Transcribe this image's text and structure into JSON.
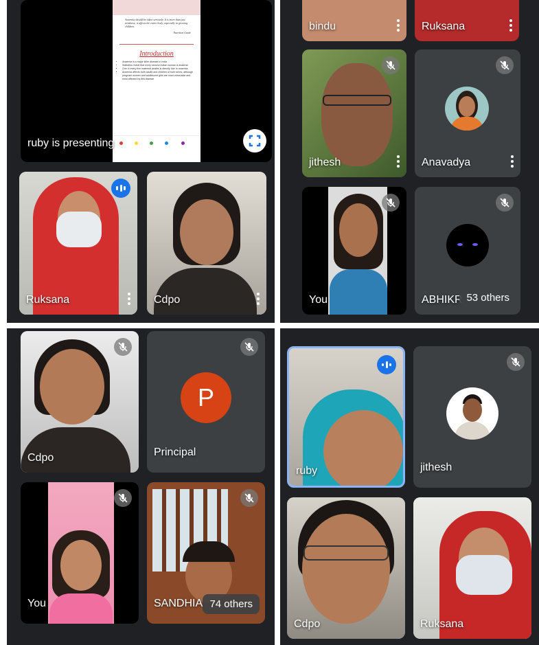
{
  "panel1": {
    "presenter_label": "ruby is presenting",
    "slide": {
      "quote": "Anaemia should be taken seriously. It is more than just tiredness; it affects the entire body, especially in growing children.",
      "quote_author": "Nutrition Guide",
      "heading": "Introduction",
      "bullets": [
        "Anaemia is a major killer disease in India",
        "Statistics reveal that every second Indian woman is anaemic",
        "One in every five maternal deaths is directly due to anaemia",
        "Anaemia affects both adults and children of both sexes, although pregnant women and adolescent girls are most vulnerable and most affected by this disease"
      ]
    },
    "tiles": [
      {
        "name": "Ruksana"
      },
      {
        "name": "Cdpo"
      }
    ]
  },
  "panel2": {
    "tiles": [
      {
        "name": "bindu"
      },
      {
        "name": "Ruksana"
      },
      {
        "name": "jithesh"
      },
      {
        "name": "Anavadya"
      },
      {
        "name": "You"
      },
      {
        "name": "ABHIKR"
      }
    ],
    "others_label": "53 others"
  },
  "panel3": {
    "tiles": [
      {
        "name": "Cdpo"
      },
      {
        "name": "Principal",
        "initial": "P"
      },
      {
        "name": "You"
      },
      {
        "name": "SANDHIA"
      }
    ],
    "others_label": "74 others"
  },
  "panel4": {
    "tiles": [
      {
        "name": "ruby"
      },
      {
        "name": "jithesh"
      },
      {
        "name": "Cdpo"
      },
      {
        "name": "Ruksana"
      }
    ]
  },
  "colors": {
    "background": "#202124",
    "tile": "#3c4043",
    "speaking_accent": "#1a73e8",
    "principal_avatar": "#d84315"
  }
}
